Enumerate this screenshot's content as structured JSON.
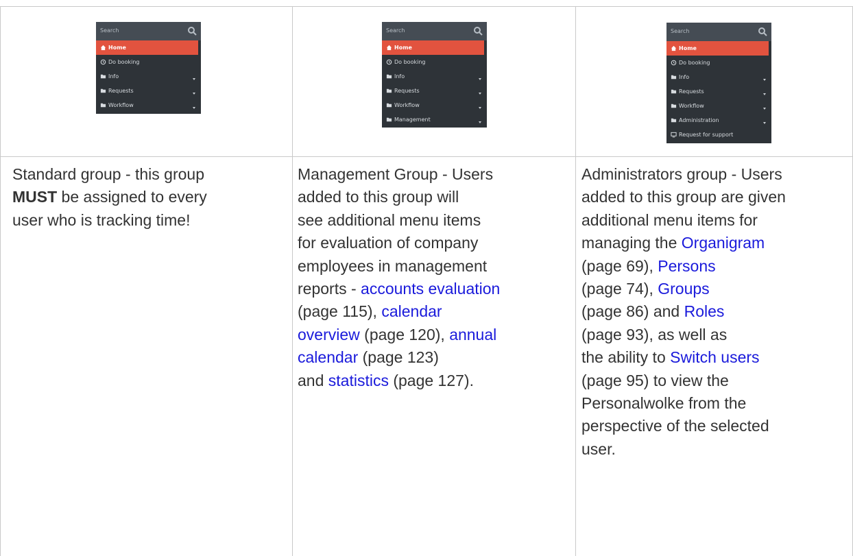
{
  "menus": {
    "standard": {
      "search_placeholder": "Search",
      "items": [
        "Home",
        "Do booking",
        "Info",
        "Requests",
        "Workflow"
      ]
    },
    "management": {
      "search_placeholder": "Search",
      "items": [
        "Home",
        "Do booking",
        "Info",
        "Requests",
        "Workflow",
        "Management"
      ]
    },
    "administrators": {
      "search_placeholder": "Search",
      "items": [
        "Home",
        "Do booking",
        "Info",
        "Requests",
        "Workflow",
        "Administration",
        "Request for support"
      ]
    }
  },
  "descriptions": {
    "standard": {
      "t1": "Standard group - this group",
      "must": "MUST",
      "t2": " be assigned to every",
      "t3": "user who is tracking time!"
    },
    "management": {
      "t1": "Management Group - Users",
      "t2": "added to this group will",
      "t3": "see additional menu items",
      "t4": "for evaluation of company",
      "t5": "employees in management",
      "t6": "reports - ",
      "link_accounts": "accounts evaluation",
      "p1": "(page 115), ",
      "link_calendar1": "calendar",
      "link_calendar2": "overview",
      "p2": " (page 120), ",
      "link_annual1": "annual",
      "link_annual2": "calendar",
      "p3": " (page 123)",
      "and": "and ",
      "link_statistics": "statistics",
      "p4": " (page 127)."
    },
    "administrators": {
      "t1": "Administrators group - Users",
      "t2": "added to this group are given",
      "t3": "additional menu items for",
      "t4": "managing the ",
      "link_organigram": "Organigram",
      "p1": "(page 69), ",
      "link_persons": "Persons",
      "p2": "(page 74), ",
      "link_groups": "Groups",
      "p3": "(page 86) and ",
      "link_roles": "Roles",
      "p4": "(page 93), as well as",
      "t5": "the ability to ",
      "link_switch": "Switch users",
      "p5": "(page 95) to view the",
      "t6": "Personalwolke from the",
      "t7": "perspective of the selected",
      "t8": "user."
    }
  },
  "colors": {
    "menu_bg": "#2e3338",
    "search_bg": "#454c54",
    "active": "#e2533f",
    "link": "#1a1adb",
    "text": "#333333",
    "border": "#c9c9c9"
  },
  "icons": [
    "search-icon",
    "home-icon",
    "clock-icon",
    "folder-icon",
    "monitor-icon",
    "chevron-down-icon"
  ]
}
